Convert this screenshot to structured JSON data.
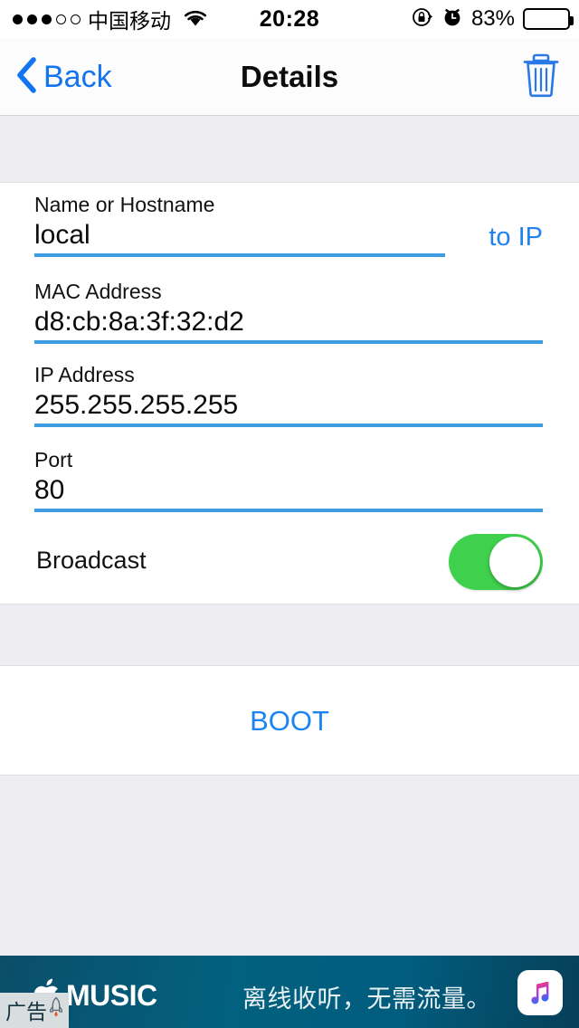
{
  "statusbar": {
    "signal_dots_filled": 3,
    "signal_dots_total": 5,
    "carrier": "中国移动",
    "wifi_icon": "wifi-icon",
    "time": "20:28",
    "rotation_lock_icon": "rotation-lock-icon",
    "alarm_icon": "alarm-clock-icon",
    "battery_percent": "83%",
    "battery_level": 83
  },
  "navbar": {
    "back_label": "Back",
    "back_icon": "chevron-left-icon",
    "title": "Details",
    "delete_icon": "trash-icon"
  },
  "form": {
    "fields": [
      {
        "label": "Name or Hostname",
        "value": "local",
        "placeholder": "Name or Hostname"
      },
      {
        "label": "MAC Address",
        "value": "d8:cb:8a:3f:32:d2",
        "placeholder": "MAC Address"
      },
      {
        "label": "IP Address",
        "value": "255.255.255.255",
        "placeholder": "IP Address"
      },
      {
        "label": "Port",
        "value": "80",
        "placeholder": "Port"
      }
    ],
    "to_ip_label": "to IP",
    "broadcast_label": "Broadcast",
    "broadcast_on": true
  },
  "actions": {
    "boot_label": "BOOT"
  },
  "ad": {
    "brand": "MUSIC",
    "apple_icon": "apple-logo-icon",
    "headline": "离线收听，无需流量。",
    "app_icon": "apple-music-icon",
    "badge_label": "广告",
    "badge_icon": "rocket-icon"
  },
  "colors": {
    "accent_blue": "#1274ef",
    "link_blue": "#1a84f5",
    "underline_blue": "#3d9de0",
    "toggle_green": "#3fd14e",
    "section_gray": "#eeedf2",
    "ad_teal": "#02617f"
  }
}
